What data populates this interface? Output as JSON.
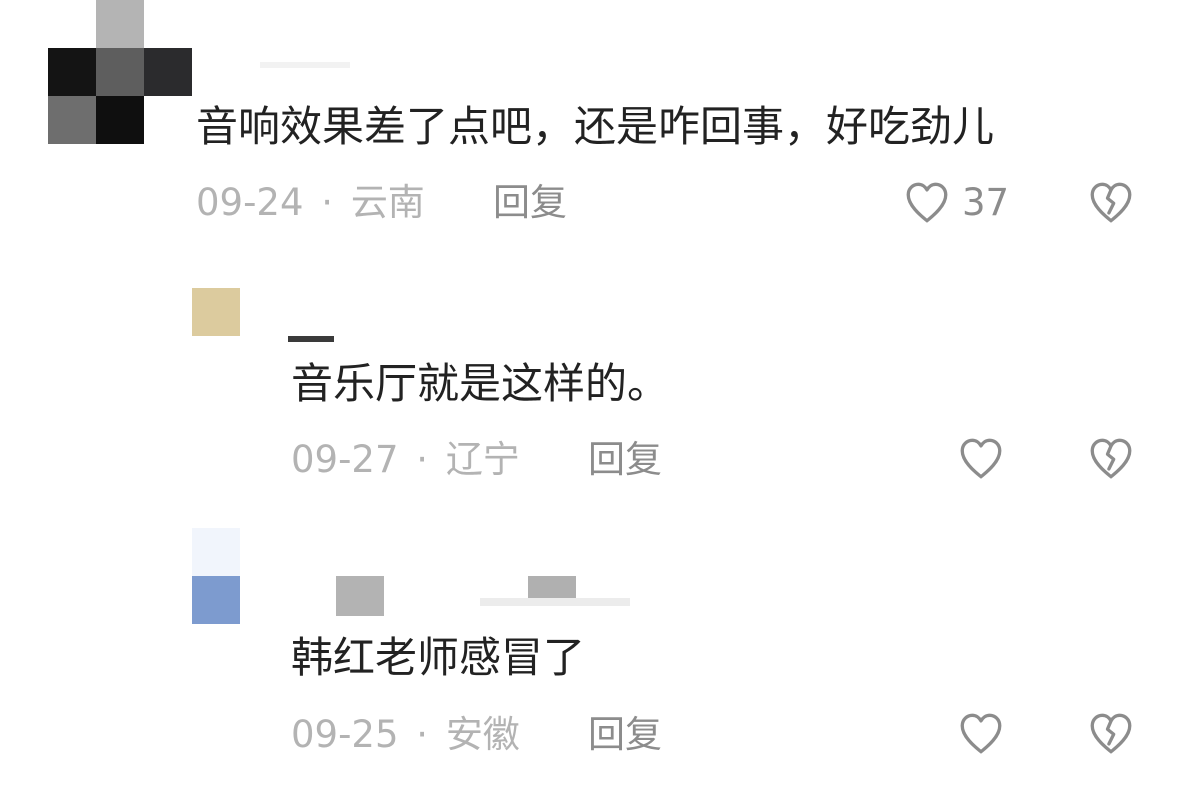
{
  "comments": [
    {
      "text": "音响效果差了点吧，还是咋回事，好吃劲儿",
      "date": "09-24",
      "location": "云南",
      "reply_label": "回复",
      "like_count": "37"
    },
    {
      "text": "音乐厅就是这样的。",
      "date": "09-27",
      "location": "辽宁",
      "reply_label": "回复",
      "like_count": ""
    },
    {
      "text": "韩红老师感冒了",
      "date": "09-25",
      "location": "安徽",
      "reply_label": "回复",
      "like_count": ""
    }
  ],
  "separator": "·",
  "icons": {
    "like": "heart-outline-icon",
    "dislike": "broken-heart-icon"
  },
  "colors": {
    "text": "#222222",
    "meta": "#b3b3b3",
    "reply": "#8c8c8c",
    "icon": "#8c8c8c"
  }
}
